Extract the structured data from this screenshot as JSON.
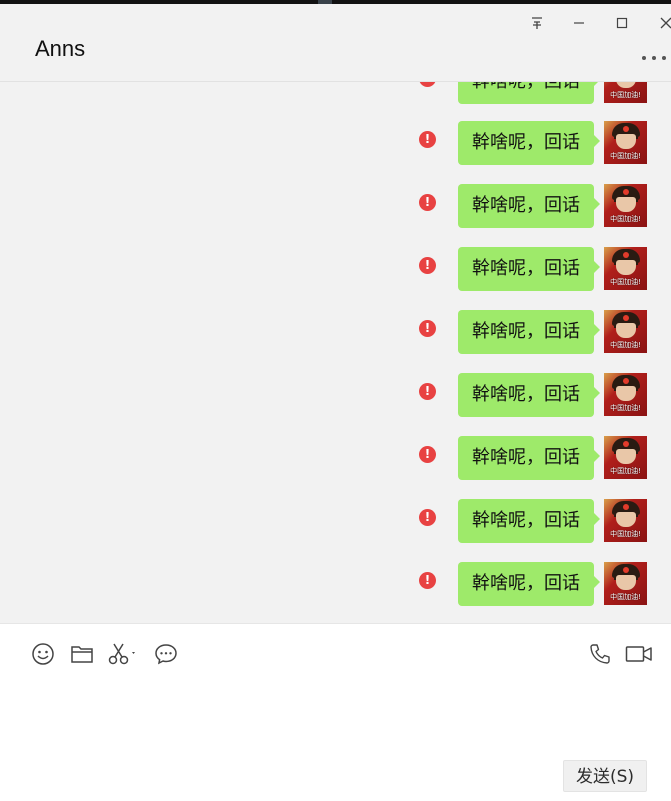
{
  "window": {
    "contact_name": "Anns",
    "pin_icon": "pin-icon",
    "minimize_icon": "minimize-icon",
    "maximize_icon": "maximize-icon",
    "close_icon": "close-icon",
    "more_icon": "more-horizontal-icon"
  },
  "messages": [
    {
      "text": "幹啥呢，回话",
      "status": "failed"
    },
    {
      "text": "幹啥呢，回话",
      "status": "failed"
    },
    {
      "text": "幹啥呢，回话",
      "status": "failed"
    },
    {
      "text": "幹啥呢，回话",
      "status": "failed"
    },
    {
      "text": "幹啥呢，回话",
      "status": "failed"
    },
    {
      "text": "幹啥呢，回话",
      "status": "failed"
    },
    {
      "text": "幹啥呢，回话",
      "status": "failed"
    },
    {
      "text": "幹啥呢，回话",
      "status": "failed"
    },
    {
      "text": "幹啥呢，回话",
      "status": "failed"
    }
  ],
  "avatar": {
    "tag": "中国加油!"
  },
  "message_status_icon": "!",
  "composer": {
    "toolbar_icons": [
      "emoji-icon",
      "folder-icon",
      "scissors-icon",
      "chat-bubble-icon",
      "phone-icon",
      "video-icon"
    ],
    "send_label": "发送(S)"
  },
  "colors": {
    "bubble": "#9eea6a",
    "error": "#e84242",
    "background": "#f2f2f2",
    "composer_bg": "#ffffff"
  }
}
